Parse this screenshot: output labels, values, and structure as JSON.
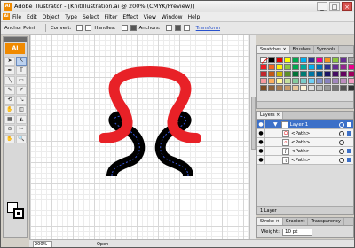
{
  "window": {
    "title": "Adobe Illustrator - [KnitIllustration.ai @ 200% (CMYK/Preview)]",
    "app_icon": "Ai",
    "minimize": "_",
    "maximize": "□",
    "close": "×"
  },
  "menubar": {
    "logo": "Ai",
    "items": [
      "File",
      "Edit",
      "Object",
      "Type",
      "Select",
      "Filter",
      "Effect",
      "View",
      "Window",
      "Help"
    ]
  },
  "control_bar": {
    "context": "Anchor Point",
    "convert": "Convert:",
    "handles": "Handles:",
    "anchors": "Anchors:",
    "transform": "Transform"
  },
  "toolbox": {
    "badge": "AI",
    "tools": [
      "➤",
      "↖",
      "✒",
      "T",
      "╲",
      "▭",
      "✎",
      "✐",
      "⟲",
      "⤡",
      "✋",
      "◫",
      "▦",
      "◭",
      "⊙",
      "✂",
      "✋",
      "🔍"
    ]
  },
  "artwork": {
    "red_stroke": "#e82127",
    "black_stroke": "#000000",
    "path_highlight": "#3a57d6"
  },
  "swatches_panel": {
    "tabs": [
      "Swatches ×",
      "Brushes",
      "Symbols"
    ],
    "colors": [
      "#ffffff",
      "#000000",
      "#e10000",
      "#ffff00",
      "#00a650",
      "#00aeef",
      "#2e3192",
      "#ec008c",
      "#f7941d",
      "#8dc63f",
      "#662d91",
      "#a0a0a0",
      "#ed1c24",
      "#f26522",
      "#fff200",
      "#8dc63f",
      "#00a651",
      "#00a99d",
      "#00aeef",
      "#0072bc",
      "#2e3192",
      "#662d91",
      "#92278f",
      "#ec008c",
      "#c1272d",
      "#c25a17",
      "#c8b400",
      "#5c8f29",
      "#007236",
      "#007b73",
      "#0076a3",
      "#004a80",
      "#1b1464",
      "#440e62",
      "#630460",
      "#9e005d",
      "#f5989d",
      "#fbaf5d",
      "#fff799",
      "#c4df9b",
      "#82ca9c",
      "#7accc8",
      "#6dcff6",
      "#8393ca",
      "#8882be",
      "#a187be",
      "#bd8cbf",
      "#f49ac1",
      "#7d4e24",
      "#8c6239",
      "#a67c52",
      "#c69c6d",
      "#e7c79c",
      "#fff4d8",
      "#dddddd",
      "#bbbbbb",
      "#999999",
      "#777777",
      "#555555",
      "#333333"
    ]
  },
  "layers_panel": {
    "tabs": [
      "Layers ×"
    ],
    "layer_name": "Layer 1",
    "rows": [
      {
        "thumb": "Ω",
        "name": "<Path>"
      },
      {
        "thumb": "∩",
        "name": "<Path>"
      },
      {
        "thumb": "ʃ",
        "name": "<Path>"
      },
      {
        "thumb": "ʅ",
        "name": "<Path>"
      }
    ],
    "footer": "1 Layer"
  },
  "stroke_panel": {
    "tabs": [
      "Stroke ×",
      "Gradient",
      "Transparency"
    ],
    "weight_label": "Weight:",
    "weight_value": "10 pt"
  },
  "status": {
    "zoom": "200%",
    "state": "Open"
  }
}
